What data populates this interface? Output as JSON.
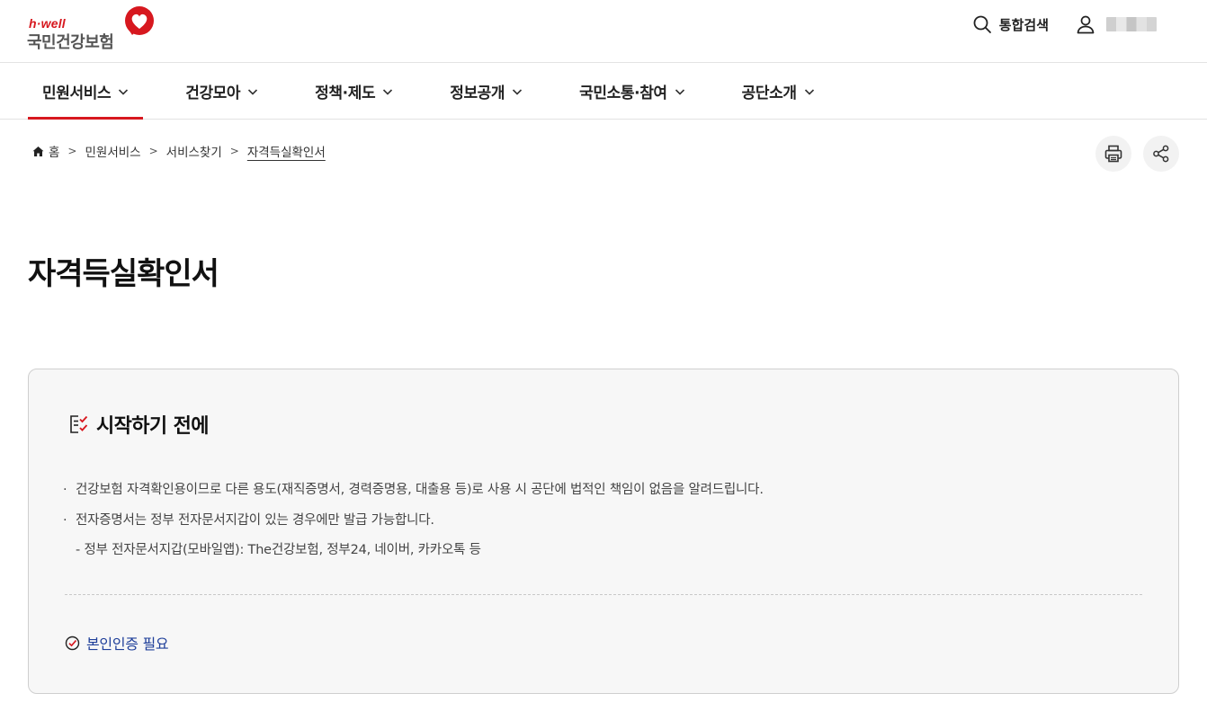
{
  "header": {
    "brand_small": "h·well",
    "brand_name": "국민건강보험",
    "search_label": "통합검색",
    "user_name_masked": "",
    "brand_color": "#d7181f"
  },
  "gnb": {
    "items": [
      {
        "label": "민원서비스",
        "active": true
      },
      {
        "label": "건강모아",
        "active": false
      },
      {
        "label": "정책·제도",
        "active": false
      },
      {
        "label": "정보공개",
        "active": false
      },
      {
        "label": "국민소통·참여",
        "active": false
      },
      {
        "label": "공단소개",
        "active": false
      }
    ]
  },
  "breadcrumb": {
    "home": "홈",
    "items": [
      "민원서비스",
      "서비스찾기",
      "자격득실확인서"
    ]
  },
  "tools": {
    "print_icon": "print-icon",
    "share_icon": "share-icon"
  },
  "page": {
    "title": "자격득실확인서"
  },
  "notice": {
    "heading": "시작하기 전에",
    "items": [
      "건강보험 자격확인용이므로 다른 용도(재직증명서, 경력증명용, 대출용 등)로 사용 시 공단에 법적인 책임이 없음을 알려드립니다.",
      "전자증명서는 정부 전자문서지갑이 있는 경우에만 발급 가능합니다."
    ],
    "sub_item": "- 정부 전자문서지갑(모바일앱): The건강보험, 정부24, 네이버, 카카오톡 등",
    "auth_label": "본인인증 필요",
    "auth_color": "#1f3f9a"
  }
}
